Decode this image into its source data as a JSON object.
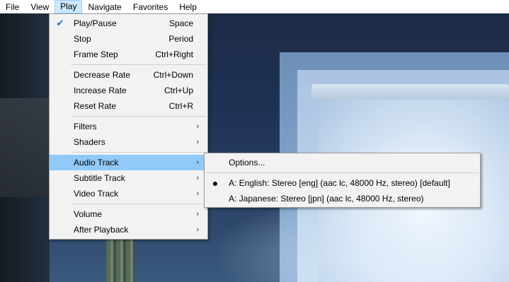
{
  "menubar": {
    "items": [
      "File",
      "View",
      "Play",
      "Navigate",
      "Favorites",
      "Help"
    ]
  },
  "play_menu": {
    "play_pause": {
      "label": "Play/Pause",
      "shortcut": "Space"
    },
    "stop": {
      "label": "Stop",
      "shortcut": "Period"
    },
    "frame_step": {
      "label": "Frame Step",
      "shortcut": "Ctrl+Right"
    },
    "decrease_rate": {
      "label": "Decrease Rate",
      "shortcut": "Ctrl+Down"
    },
    "increase_rate": {
      "label": "Increase Rate",
      "shortcut": "Ctrl+Up"
    },
    "reset_rate": {
      "label": "Reset Rate",
      "shortcut": "Ctrl+R"
    },
    "filters": {
      "label": "Filters"
    },
    "shaders": {
      "label": "Shaders"
    },
    "audio_track": {
      "label": "Audio Track"
    },
    "subtitle_track": {
      "label": "Subtitle Track"
    },
    "video_track": {
      "label": "Video Track"
    },
    "volume": {
      "label": "Volume"
    },
    "after_playback": {
      "label": "After Playback"
    }
  },
  "audio_menu": {
    "options": "Options...",
    "tracks": [
      "A: English: Stereo [eng] (aac lc, 48000 Hz, stereo) [default]",
      "A: Japanese: Stereo [jpn] (aac lc, 48000 Hz, stereo)"
    ]
  },
  "glyphs": {
    "check": "✔",
    "arrow": "›",
    "dot": "●"
  }
}
